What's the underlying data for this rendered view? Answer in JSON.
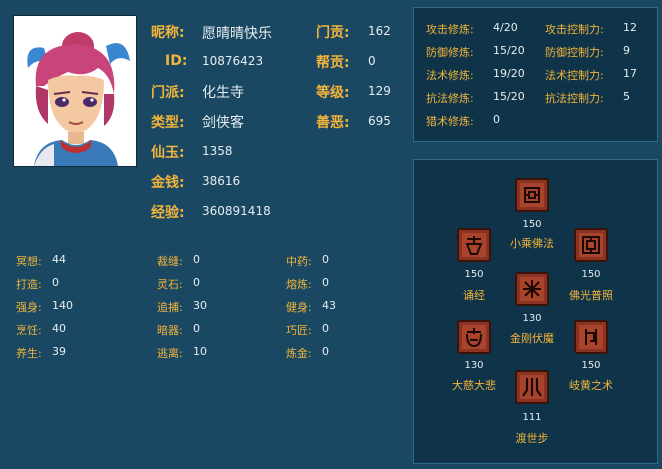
{
  "profile": {
    "nickname": {
      "label": "昵称:",
      "value": "愿晴晴快乐"
    },
    "id": {
      "label": "ID:",
      "value": "10876423"
    },
    "sect": {
      "label": "门派:",
      "value": "化生寺"
    },
    "type": {
      "label": "类型:",
      "value": "剑侠客"
    },
    "xianyu": {
      "label": "仙玉:",
      "value": "1358"
    },
    "money": {
      "label": "金钱:",
      "value": "38616"
    },
    "exp": {
      "label": "经验:",
      "value": "360891418"
    },
    "sect_contrib": {
      "label": "门贡:",
      "value": "162"
    },
    "guild_contrib": {
      "label": "帮贡:",
      "value": "0"
    },
    "level": {
      "label": "等级:",
      "value": "129"
    },
    "karma": {
      "label": "善恶:",
      "value": "695"
    }
  },
  "life_skills": [
    {
      "label": "冥想:",
      "value": "44"
    },
    {
      "label": "打造:",
      "value": "0"
    },
    {
      "label": "强身:",
      "value": "140"
    },
    {
      "label": "烹饪:",
      "value": "40"
    },
    {
      "label": "养生:",
      "value": "39"
    },
    {
      "label": "裁缝:",
      "value": "0"
    },
    {
      "label": "灵石:",
      "value": "0"
    },
    {
      "label": "追捕:",
      "value": "30"
    },
    {
      "label": "暗器:",
      "value": "0"
    },
    {
      "label": "逃离:",
      "value": "10"
    },
    {
      "label": "中药:",
      "value": "0"
    },
    {
      "label": "熔炼:",
      "value": "0"
    },
    {
      "label": "健身:",
      "value": "43"
    },
    {
      "label": "巧匠:",
      "value": "0"
    },
    {
      "label": "炼金:",
      "value": "0"
    }
  ],
  "cultivation": [
    {
      "label": "攻击修炼:",
      "value": "4/20"
    },
    {
      "label": "防御修炼:",
      "value": "15/20"
    },
    {
      "label": "法术修炼:",
      "value": "19/20"
    },
    {
      "label": "抗法修炼:",
      "value": "15/20"
    },
    {
      "label": "猎术修炼:",
      "value": "0"
    },
    {
      "label": "攻击控制力:",
      "value": "12"
    },
    {
      "label": "防御控制力:",
      "value": "9"
    },
    {
      "label": "法术控制力:",
      "value": "17"
    },
    {
      "label": "抗法控制力:",
      "value": "5"
    }
  ],
  "sect_skills": [
    {
      "name": "小乘佛法",
      "level": "150",
      "icon": "buddhism-seal-icon"
    },
    {
      "name": "诵经",
      "level": "150",
      "icon": "chant-icon"
    },
    {
      "name": "佛光普照",
      "level": "150",
      "icon": "buddha-light-icon"
    },
    {
      "name": "金刚伏魔",
      "level": "130",
      "icon": "vajra-icon"
    },
    {
      "name": "大慈大悲",
      "level": "130",
      "icon": "compassion-icon"
    },
    {
      "name": "岐黄之术",
      "level": "150",
      "icon": "medicine-icon"
    },
    {
      "name": "渡世步",
      "level": "111",
      "icon": "footstep-icon"
    }
  ],
  "colors": {
    "label": "#f2b43a",
    "value": "#e6ecf0",
    "background": "#1a4862",
    "panel": "#0f3348",
    "icon": "#8a3322"
  }
}
